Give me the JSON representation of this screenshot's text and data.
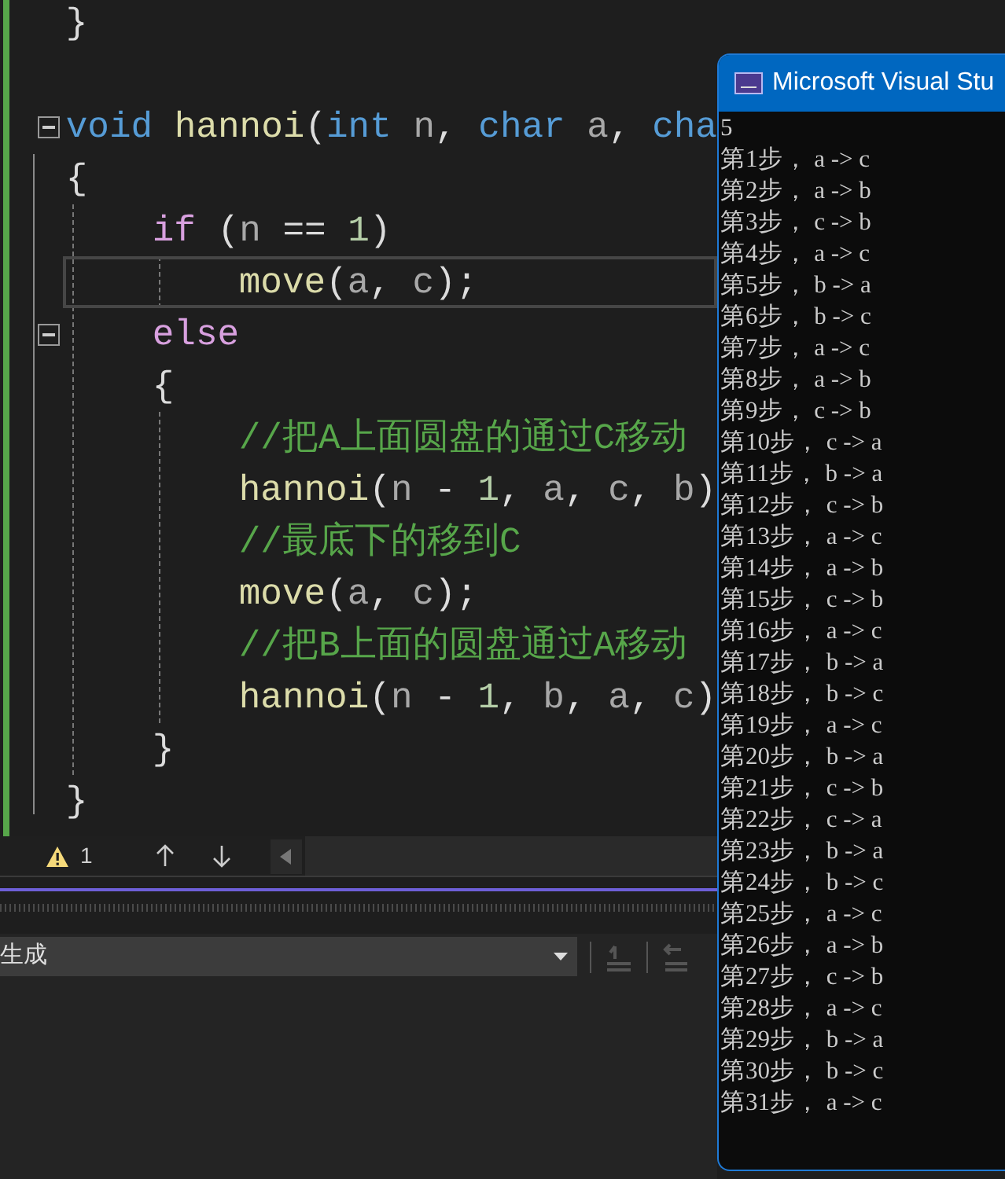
{
  "editor": {
    "lines": [
      {
        "kind": "code",
        "tokens": [
          {
            "text": "}",
            "kind": "plain"
          }
        ]
      },
      {
        "kind": "blank"
      },
      {
        "kind": "code",
        "fold": {
          "expanded": true
        },
        "tokens": [
          {
            "text": "void ",
            "kind": "keyword"
          },
          {
            "text": "hannoi",
            "kind": "function"
          },
          {
            "text": "(",
            "kind": "plain"
          },
          {
            "text": "int ",
            "kind": "keyword"
          },
          {
            "text": "n",
            "kind": "param"
          },
          {
            "text": ", ",
            "kind": "plain"
          },
          {
            "text": "char ",
            "kind": "keyword"
          },
          {
            "text": "a",
            "kind": "param"
          },
          {
            "text": ", ",
            "kind": "plain"
          },
          {
            "text": "cha",
            "kind": "keyword"
          }
        ]
      },
      {
        "kind": "code",
        "tokens": [
          {
            "text": "{",
            "kind": "plain"
          }
        ],
        "children": [
          {
            "kind": "code",
            "tokens": [
              {
                "text": "if ",
                "kind": "control"
              },
              {
                "text": "(",
                "kind": "plain"
              },
              {
                "text": "n",
                "kind": "param"
              },
              {
                "text": " == ",
                "kind": "plain"
              },
              {
                "text": "1",
                "kind": "number"
              },
              {
                "text": ")",
                "kind": "plain"
              }
            ],
            "children": [
              {
                "kind": "code",
                "current": true,
                "tokens": [
                  {
                    "text": "move",
                    "kind": "function"
                  },
                  {
                    "text": "(",
                    "kind": "plain"
                  },
                  {
                    "text": "a",
                    "kind": "param"
                  },
                  {
                    "text": ", ",
                    "kind": "plain"
                  },
                  {
                    "text": "c",
                    "kind": "param"
                  },
                  {
                    "text": ");",
                    "kind": "plain"
                  }
                ]
              }
            ]
          },
          {
            "kind": "code",
            "fold": {
              "expanded": true
            },
            "tokens": [
              {
                "text": "else",
                "kind": "control"
              }
            ]
          },
          {
            "kind": "code",
            "tokens": [
              {
                "text": "{",
                "kind": "plain"
              }
            ],
            "children": [
              {
                "kind": "code",
                "tokens": [
                  {
                    "text": "//把A上面圆盘的通过C移动",
                    "kind": "comment"
                  }
                ]
              },
              {
                "kind": "code",
                "tokens": [
                  {
                    "text": "hannoi",
                    "kind": "function"
                  },
                  {
                    "text": "(",
                    "kind": "plain"
                  },
                  {
                    "text": "n",
                    "kind": "param"
                  },
                  {
                    "text": " - ",
                    "kind": "plain"
                  },
                  {
                    "text": "1",
                    "kind": "number"
                  },
                  {
                    "text": ", ",
                    "kind": "plain"
                  },
                  {
                    "text": "a",
                    "kind": "param"
                  },
                  {
                    "text": ", ",
                    "kind": "plain"
                  },
                  {
                    "text": "c",
                    "kind": "param"
                  },
                  {
                    "text": ", ",
                    "kind": "plain"
                  },
                  {
                    "text": "b",
                    "kind": "param"
                  },
                  {
                    "text": ")",
                    "kind": "plain"
                  }
                ]
              },
              {
                "kind": "code",
                "tokens": [
                  {
                    "text": "//最底下的移到C",
                    "kind": "comment"
                  }
                ]
              },
              {
                "kind": "code",
                "tokens": [
                  {
                    "text": "move",
                    "kind": "function"
                  },
                  {
                    "text": "(",
                    "kind": "plain"
                  },
                  {
                    "text": "a",
                    "kind": "param"
                  },
                  {
                    "text": ", ",
                    "kind": "plain"
                  },
                  {
                    "text": "c",
                    "kind": "param"
                  },
                  {
                    "text": ");",
                    "kind": "plain"
                  }
                ]
              },
              {
                "kind": "code",
                "tokens": [
                  {
                    "text": "//把B上面的圆盘通过A移动",
                    "kind": "comment"
                  }
                ]
              },
              {
                "kind": "code",
                "tokens": [
                  {
                    "text": "hannoi",
                    "kind": "function"
                  },
                  {
                    "text": "(",
                    "kind": "plain"
                  },
                  {
                    "text": "n",
                    "kind": "param"
                  },
                  {
                    "text": " - ",
                    "kind": "plain"
                  },
                  {
                    "text": "1",
                    "kind": "number"
                  },
                  {
                    "text": ", ",
                    "kind": "plain"
                  },
                  {
                    "text": "b",
                    "kind": "param"
                  },
                  {
                    "text": ", ",
                    "kind": "plain"
                  },
                  {
                    "text": "a",
                    "kind": "param"
                  },
                  {
                    "text": ", ",
                    "kind": "plain"
                  },
                  {
                    "text": "c",
                    "kind": "param"
                  },
                  {
                    "text": ")",
                    "kind": "plain"
                  }
                ]
              }
            ]
          },
          {
            "kind": "code",
            "tokens": [
              {
                "text": "}",
                "kind": "plain"
              }
            ]
          }
        ]
      },
      {
        "kind": "code",
        "tokens": [
          {
            "text": "}",
            "kind": "plain"
          }
        ]
      }
    ]
  },
  "status_bar": {
    "warnings": "1"
  },
  "output": {
    "source": "生成"
  },
  "console": {
    "title": "Microsoft Visual Stu",
    "lines": [
      "5",
      "第1步， a -> c",
      "第2步， a -> b",
      "第3步， c -> b",
      "第4步， a -> c",
      "第5步， b -> a",
      "第6步， b -> c",
      "第7步， a -> c",
      "第8步， a -> b",
      "第9步， c -> b",
      "第10步， c -> a",
      "第11步， b -> a",
      "第12步， c -> b",
      "第13步， a -> c",
      "第14步， a -> b",
      "第15步， c -> b",
      "第16步， a -> c",
      "第17步， b -> a",
      "第18步， b -> c",
      "第19步， a -> c",
      "第20步， b -> a",
      "第21步， c -> b",
      "第22步， c -> a",
      "第23步， b -> a",
      "第24步， b -> c",
      "第25步， a -> c",
      "第26步， a -> b",
      "第27步， c -> b",
      "第28步， a -> c",
      "第29步， b -> a",
      "第30步， b -> c",
      "第31步， a -> c"
    ]
  }
}
